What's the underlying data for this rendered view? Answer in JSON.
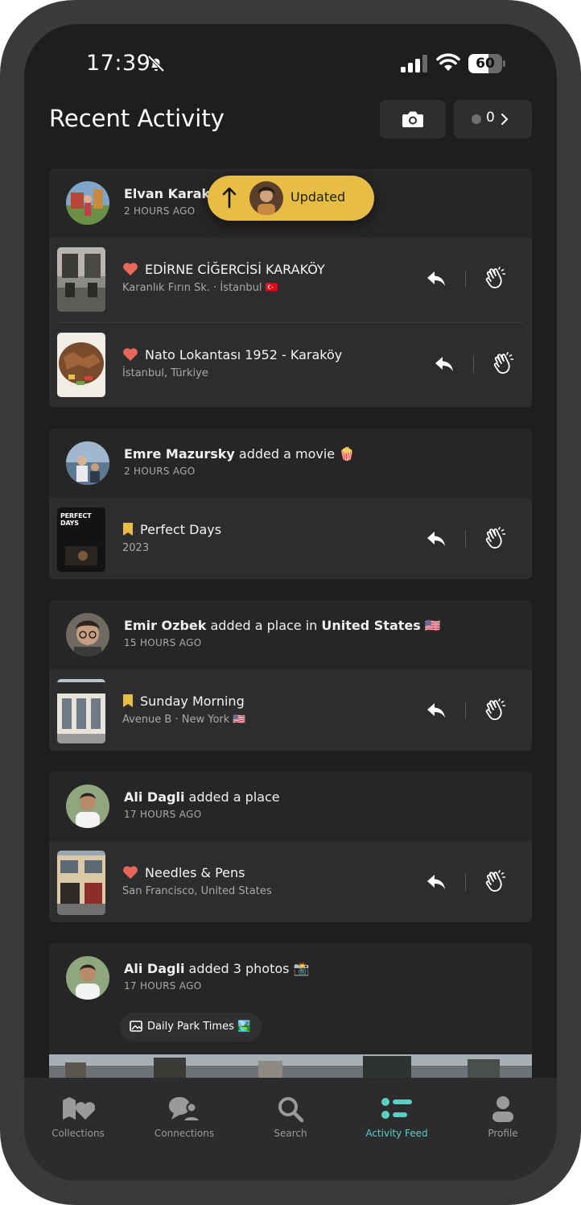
{
  "status_bar": {
    "time": "17:39",
    "battery": "60",
    "battery_level": 0.6
  },
  "header": {
    "title": "Recent Activity",
    "counter": "0"
  },
  "toast": {
    "label": "Updated"
  },
  "feed": [
    {
      "user": "Elvan Karakir",
      "action": "",
      "time": "2 HOURS AGO",
      "items": [
        {
          "icon": "heart-icon",
          "title": "EDİRNE CİĞERCİSİ KARAKÖY",
          "subtitle": "Karanlık Fırın Sk. · İstanbul 🇹🇷"
        },
        {
          "icon": "heart-icon",
          "title": "Nato Lokantası 1952 - Karaköy",
          "subtitle": "İstanbul, Türkiye"
        }
      ]
    },
    {
      "user": "Emre Mazursky",
      "action": " added a movie 🍿",
      "time": "2 HOURS AGO",
      "items": [
        {
          "icon": "bookmark-icon",
          "title": "Perfect Days",
          "subtitle": "2023",
          "poster_text": "PERFECT DAYS"
        }
      ]
    },
    {
      "user": "Emir Ozbek",
      "action": " added a place in ",
      "place": "United States",
      "flag": " 🇺🇸",
      "time": "15 HOURS AGO",
      "items": [
        {
          "icon": "bookmark-icon",
          "title": "Sunday Morning",
          "subtitle": "Avenue B · New York 🇺🇸"
        }
      ]
    },
    {
      "user": "Ali Dagli",
      "action": " added a place",
      "time": "17 HOURS AGO",
      "items": [
        {
          "icon": "heart-icon",
          "title": "Needles & Pens",
          "subtitle": "San Francisco, United States"
        }
      ]
    },
    {
      "user": "Ali Dagli",
      "action": " added 3 photos 📸",
      "time": "17 HOURS AGO",
      "collection": "Daily Park Times 🏞️"
    }
  ],
  "tabs": [
    {
      "label": "Collections",
      "icon": "collections-icon"
    },
    {
      "label": "Connections",
      "icon": "connections-icon"
    },
    {
      "label": "Search",
      "icon": "search-icon"
    },
    {
      "label": "Activity Feed",
      "icon": "activity-feed-icon",
      "active": true
    },
    {
      "label": "Profile",
      "icon": "profile-icon"
    }
  ],
  "colors": {
    "background": "#1e1e1f",
    "card": "#262627",
    "accent": "#e8bd45",
    "active_tab": "#5ccfc3",
    "heart": "#e8665a",
    "bookmark": "#e8bd45"
  }
}
